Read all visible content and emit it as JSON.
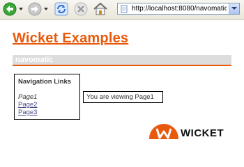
{
  "browser": {
    "url": "http://localhost:8080/navomatic",
    "buttons": {
      "back": "back-arrow",
      "forward": "forward-arrow",
      "refresh": "refresh",
      "stop": "stop",
      "home": "home"
    }
  },
  "page": {
    "title": "Wicket Examples",
    "subheader": "navomatic",
    "nav": {
      "heading": "Navigation Links",
      "items": [
        {
          "label": "Page1",
          "current": true
        },
        {
          "label": "Page2",
          "current": false
        },
        {
          "label": "Page3",
          "current": false
        }
      ]
    },
    "message": "You are viewing Page1",
    "logo_text": "WICKET"
  },
  "colors": {
    "accent": "#e8590c",
    "subheader_bg": "#dddddd",
    "link": "#4a4a8a"
  }
}
